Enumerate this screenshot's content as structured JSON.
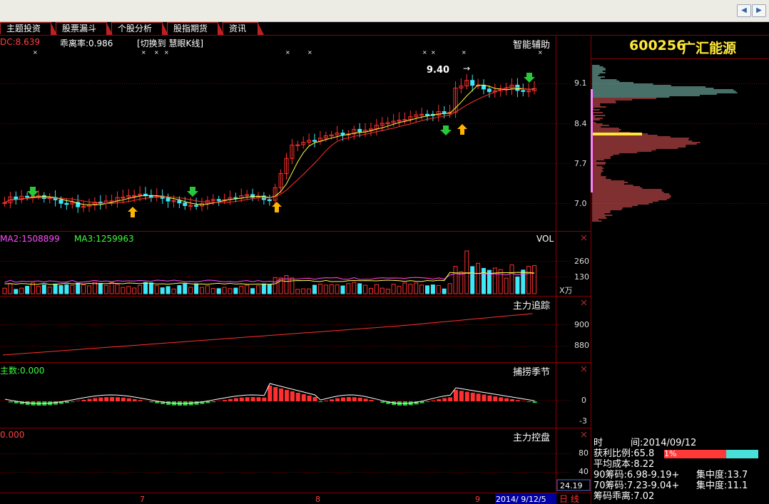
{
  "tabs": [
    "主题投资",
    "股票漏斗",
    "个股分析",
    "股指期货",
    "资讯"
  ],
  "nav": {
    "back": "◀",
    "forward": "▶"
  },
  "main_panel": {
    "indicator_dc": "DC:8.639",
    "deviation_label": "乖离率:0.986",
    "switch_text": "[切换到  慧眼K线]",
    "panel_title": "智能辅助",
    "price_label": "9.40",
    "y_ticks": [
      "9.1",
      "8.4",
      "7.7",
      "7.0"
    ]
  },
  "volume_panel": {
    "ma2": "MA2:1508899",
    "ma3": "MA3:1259963",
    "title": "VOL",
    "y_ticks": [
      "260",
      "130"
    ],
    "unit": "X万"
  },
  "tracking_panel": {
    "title": "主力追踪",
    "y_ticks": [
      "900",
      "880"
    ]
  },
  "season_panel": {
    "indicator": "主数:0.000",
    "title": "捕捞季节",
    "y_ticks": [
      "0",
      "-3"
    ]
  },
  "control_panel": {
    "indicator": "0.000",
    "title": "主力控盘",
    "y_ticks": [
      "80",
      "40"
    ],
    "current_value": "24.19"
  },
  "x_axis": {
    "labels": [
      "7",
      "8",
      "9"
    ],
    "date": "2014/ 9/12/5",
    "period": "日 线"
  },
  "stock_info": {
    "code": "600256",
    "name": "广汇能源"
  },
  "chip_stats": {
    "time_label": "时",
    "time_value": "间:2014/09/12",
    "profit_label": "获利比例:65.8",
    "profit_pct_text": "1%",
    "profit_ratio": 0.658,
    "avg_cost": "平均成本:8.22",
    "chip90": "90筹码:6.98-9.19+",
    "conc90": "集中度:13.7",
    "chip70": "70筹码:7.23-9.04+",
    "conc70": "集中度:11.1",
    "deviation": "筹码乖离:7.02"
  },
  "colors": {
    "up": "#ff3030",
    "down": "#3fe7f7",
    "accent_yellow": "#ffe83a",
    "grid": "#7a0000",
    "green_arrow": "#29c83b",
    "orange_arrow": "#ffb400"
  }
}
